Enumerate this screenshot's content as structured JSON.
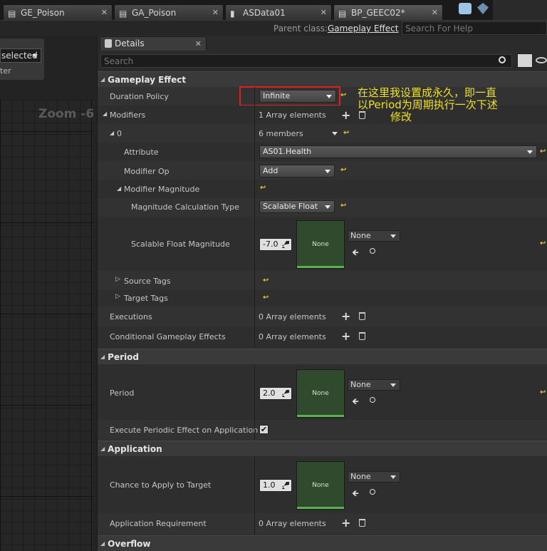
{
  "tabs": [
    {
      "label": "GE_Poison"
    },
    {
      "label": "GA_Poison"
    },
    {
      "label": "ASData01"
    },
    {
      "label": "BP_GEEC02*"
    }
  ],
  "toolbar": {
    "parent_class_label": "Parent class:",
    "parent_class_value": "Gameplay Effect",
    "search_help_placeholder": "Search For Help"
  },
  "left": {
    "selected": "selected",
    "filter": "ter",
    "zoom": "Zoom -6"
  },
  "details": {
    "tab_label": "Details",
    "search_placeholder": "Search"
  },
  "annotation": {
    "line1": "在这里我设置成永久，即一直",
    "line2": "以Period为周期执行一次下述",
    "line3": "修改"
  },
  "sections": {
    "gameplay_effect": {
      "title": "Gameplay Effect",
      "duration_policy": {
        "label": "Duration Policy",
        "value": "Infinite"
      },
      "modifiers": {
        "label": "Modifiers",
        "value": "1 Array elements"
      },
      "index0": {
        "label": "0",
        "value": "6 members"
      },
      "attribute": {
        "label": "Attribute",
        "value": "AS01.Health"
      },
      "modifier_op": {
        "label": "Modifier Op",
        "value": "Add"
      },
      "modifier_magnitude": {
        "label": "Modifier Magnitude"
      },
      "calc_type": {
        "label": "Magnitude Calculation Type",
        "value": "Scalable Float"
      },
      "scalable": {
        "label": "Scalable Float Magnitude",
        "value": "-7.0",
        "thumb": "None",
        "curve": "None"
      },
      "source_tags": {
        "label": "Source Tags"
      },
      "target_tags": {
        "label": "Target Tags"
      },
      "executions": {
        "label": "Executions",
        "value": "0 Array elements"
      },
      "conditional": {
        "label": "Conditional Gameplay Effects",
        "value": "0 Array elements"
      }
    },
    "period": {
      "title": "Period",
      "period": {
        "label": "Period",
        "value": "2.0",
        "thumb": "None",
        "curve": "None"
      },
      "execute_on_app": {
        "label": "Execute Periodic Effect on Application",
        "checked": "✔"
      }
    },
    "application": {
      "title": "Application",
      "chance": {
        "label": "Chance to Apply to Target",
        "value": "1.0",
        "thumb": "None",
        "curve": "None"
      },
      "requirement": {
        "label": "Application Requirement",
        "value": "0 Array elements"
      }
    },
    "overflow": {
      "title": "Overflow"
    }
  },
  "colors": {
    "highlight_box": "#e02020",
    "annotation": "#f0e028",
    "reset_arrow": "#e8c43a"
  }
}
